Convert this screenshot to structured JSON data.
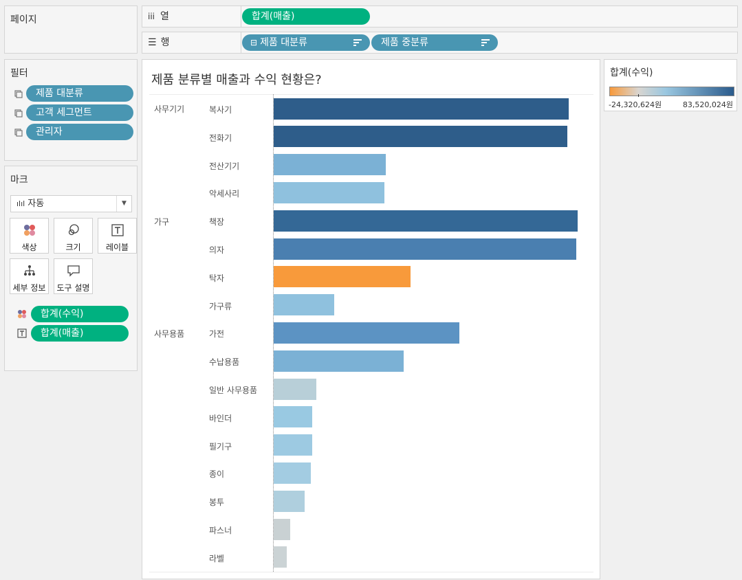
{
  "pages_panel": {
    "title": "페이지"
  },
  "columns_shelf": {
    "label": "열",
    "pills": [
      "합계(매출)"
    ]
  },
  "rows_shelf": {
    "label": "행",
    "pills": [
      "제품 대분류",
      "제품 중분류"
    ]
  },
  "filters_panel": {
    "title": "필터",
    "items": [
      "제품 대분류",
      "고객 세그먼트",
      "관리자"
    ]
  },
  "marks_panel": {
    "title": "마크",
    "mark_type": "자동",
    "buttons": [
      "색상",
      "크기",
      "레이블",
      "세부 정보",
      "도구 설명"
    ],
    "fields": [
      "합계(수익)",
      "합계(매출)"
    ]
  },
  "legend": {
    "title": "합계(수익)",
    "min_label": "-24,320,624원",
    "max_label": "83,520,024원",
    "colors": [
      "#f89a3b",
      "#d9d5d0",
      "#9ac7e0",
      "#2b5b8c"
    ]
  },
  "viz": {
    "title": "제품 분류별 매출과 수익 현황은?",
    "categories": [
      "사무기기",
      "가구",
      "사무용품"
    ]
  },
  "chart_data": {
    "type": "bar",
    "title": "제품 분류별 매출과 수익 현황은?",
    "orientation": "horizontal",
    "measure": "합계(매출)",
    "color_measure": "합계(수익)",
    "groups": [
      {
        "category": "사무기기",
        "items": [
          {
            "name": "복사기",
            "sales": 100,
            "color": "#2e5d8a"
          },
          {
            "name": "전화기",
            "sales": 99.5,
            "color": "#2e5d8a"
          },
          {
            "name": "전산기기",
            "sales": 38,
            "color": "#7bb1d5"
          },
          {
            "name": "악세사리",
            "sales": 37.5,
            "color": "#8fc1de"
          }
        ]
      },
      {
        "category": "가구",
        "items": [
          {
            "name": "책장",
            "sales": 103,
            "color": "#346896"
          },
          {
            "name": "의자",
            "sales": 102.5,
            "color": "#4a7fb0"
          },
          {
            "name": "탁자",
            "sales": 46.5,
            "color": "#f89a3b"
          },
          {
            "name": "가구류",
            "sales": 20.5,
            "color": "#8fc1de"
          }
        ]
      },
      {
        "category": "사무용품",
        "items": [
          {
            "name": "가전",
            "sales": 63,
            "color": "#5c93c3"
          },
          {
            "name": "수납용품",
            "sales": 44,
            "color": "#7bb1d5"
          },
          {
            "name": "일반 사무용품",
            "sales": 14.5,
            "color": "#b8cfd8"
          },
          {
            "name": "바인더",
            "sales": 13,
            "color": "#99c9e2"
          },
          {
            "name": "필기구",
            "sales": 13,
            "color": "#9dcae2"
          },
          {
            "name": "종이",
            "sales": 12.5,
            "color": "#a3cce2"
          },
          {
            "name": "봉투",
            "sales": 10.5,
            "color": "#afcfde"
          },
          {
            "name": "파스너",
            "sales": 5.5,
            "color": "#c9d1d3"
          },
          {
            "name": "라벨",
            "sales": 4.5,
            "color": "#cbd3d5"
          }
        ]
      }
    ]
  }
}
